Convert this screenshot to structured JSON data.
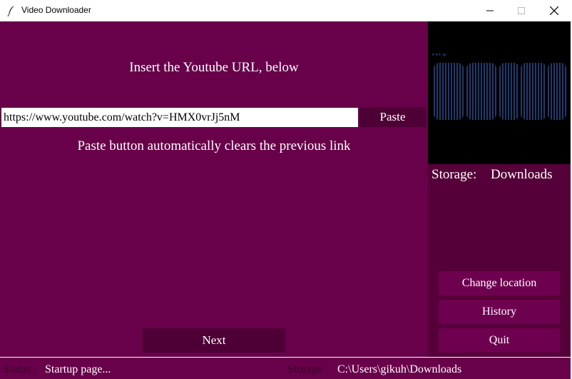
{
  "window": {
    "title": "Video Downloader",
    "icon": "feather-icon"
  },
  "main": {
    "instruction": "Insert the Youtube URL, below",
    "url_value": "https://www.youtube.com/watch?v=HMX0vrJj5nM",
    "paste_label": "Paste",
    "hint": "Paste button automatically clears the previous link",
    "next_label": "Next"
  },
  "side": {
    "storage_label": "Storage:",
    "storage_value": "Downloads",
    "buttons": {
      "change_location": "Change location",
      "history": "History",
      "quit": "Quit"
    }
  },
  "status": {
    "status_label": "Status :",
    "status_value": "Startup page...",
    "storage_label": "Storage :",
    "storage_value": "C:\\Users\\gikuh\\Downloads"
  },
  "colors": {
    "main_bg": "#68004a",
    "side_bg": "#550038",
    "button_bg": "#4e0036",
    "side_button_bg": "#6e0050",
    "status_label": "#3a0028"
  }
}
